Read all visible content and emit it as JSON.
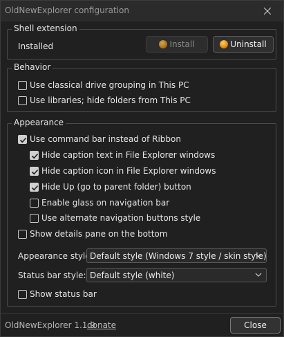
{
  "window": {
    "title": "OldNewExplorer configuration"
  },
  "shell_extension": {
    "group_label": "Shell extension",
    "status": "Installed",
    "install_label": "Install",
    "uninstall_label": "Uninstall"
  },
  "behavior": {
    "group_label": "Behavior",
    "options": [
      {
        "label": "Use classical drive grouping in This PC",
        "checked": false
      },
      {
        "label": "Use libraries; hide folders from This PC",
        "checked": false
      }
    ]
  },
  "appearance": {
    "group_label": "Appearance",
    "use_command_bar": {
      "label": "Use command bar instead of Ribbon",
      "checked": true
    },
    "sub_options": [
      {
        "label": "Hide caption text in File Explorer windows",
        "checked": true
      },
      {
        "label": "Hide caption icon in File Explorer windows",
        "checked": true
      },
      {
        "label": "Hide Up (go to parent folder) button",
        "checked": true
      },
      {
        "label": "Enable glass on navigation bar",
        "checked": false
      },
      {
        "label": "Use alternate navigation buttons style",
        "checked": false
      }
    ],
    "details_pane": {
      "label": "Show details pane on the bottom",
      "checked": false
    },
    "appearance_style_label": "Appearance style:",
    "appearance_style_value": "Default style (Windows 7 style / skin style)",
    "status_bar_style_label": "Status bar style:",
    "status_bar_style_value": "Default style (white)",
    "show_status_bar": {
      "label": "Show status bar",
      "checked": false
    }
  },
  "footer": {
    "version": "OldNewExplorer 1.1.9",
    "donate_label": "donate",
    "close_label": "Close"
  },
  "icons": {
    "window_close": "close-icon",
    "uac_shield": "uac-shield-icon",
    "dropdown": "chevron-down-icon",
    "checkmark": "checkmark-icon"
  }
}
